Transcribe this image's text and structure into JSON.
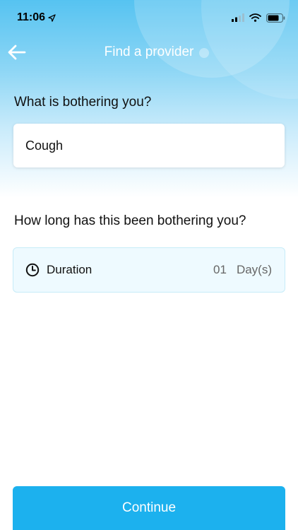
{
  "status_bar": {
    "time": "11:06",
    "icons": [
      "location-arrow-icon",
      "cellular-signal-icon",
      "wifi-icon",
      "battery-icon"
    ]
  },
  "nav": {
    "title": "Find a provider",
    "back_icon": "back-arrow-icon"
  },
  "symptom": {
    "question": "What is bothering you?",
    "value": "Cough"
  },
  "duration": {
    "question": "How long has this been bothering you?",
    "icon": "clock-icon",
    "label": "Duration",
    "amount": "01",
    "unit": "Day(s)"
  },
  "actions": {
    "continue_label": "Continue"
  },
  "colors": {
    "header_gradient_top": "#56c3f1",
    "accent": "#1cb1ee",
    "duration_bg": "#eefaff"
  }
}
